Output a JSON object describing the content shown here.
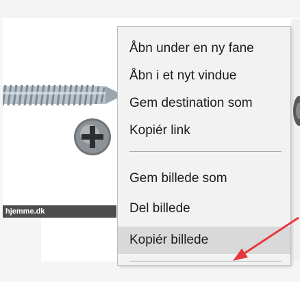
{
  "caption": "hjemme.dk",
  "context_menu": {
    "items": [
      {
        "label": "Åbn under en ny fane"
      },
      {
        "label": "Åbn i et nyt vindue"
      },
      {
        "label": "Gem destination som"
      },
      {
        "label": "Kopiér link"
      },
      {
        "label": "Gem billede som"
      },
      {
        "label": "Del billede"
      },
      {
        "label": "Kopiér billede",
        "highlighted": true
      }
    ]
  },
  "colors": {
    "menu_background": "#f2f2f2",
    "highlight": "#d9d9d9",
    "arrow": "#e8383d",
    "caption_bar": "#4d4d4d"
  },
  "icons": [
    "screw-image",
    "screw-head-icon",
    "red-arrow-annotation"
  ]
}
